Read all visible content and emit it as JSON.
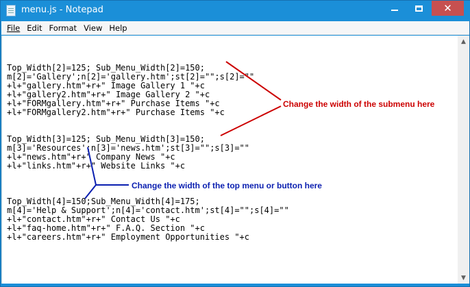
{
  "window": {
    "title": "menu.js - Notepad"
  },
  "titlebar": {
    "minimize_icon": "minimize-icon",
    "maximize_icon": "maximize-icon",
    "close_icon": "close-icon"
  },
  "menubar": {
    "items": [
      "File",
      "Edit",
      "Format",
      "View",
      "Help"
    ]
  },
  "editor": {
    "lines": [
      "",
      "Top_Width[2]=125; Sub_Menu_Width[2]=150;",
      "m[2]='Gallery';n[2]='gallery.htm';st[2]=\"\";s[2]=\"\"",
      "+l+\"gallery.htm\"+r+\" Image Gallery 1 \"+c",
      "+l+\"gallery2.htm\"+r+\" Image Gallery 2 \"+c",
      "+l+\"FORMgallery.htm\"+r+\" Purchase Items \"+c",
      "+l+\"FORMgallery2.htm\"+r+\" Purchase Items \"+c",
      "",
      "",
      "Top_Width[3]=125; Sub_Menu_Width[3]=150;",
      "m[3]='Resources';n[3]='news.htm';st[3]=\"\";s[3]=\"\"",
      "+l+\"news.htm\"+r+\" Company News \"+c",
      "+l+\"links.htm\"+r+\" Website Links \"+c",
      "",
      "",
      "",
      "Top_Width[4]=150;Sub_Menu_Width[4]=175;",
      "m[4]='Help & Support';n[4]='contact.htm';st[4]=\"\";s[4]=\"\"",
      "+l+\"contact.htm\"+r+\" Contact Us \"+c",
      "+l+\"faq-home.htm\"+r+\" F.A.Q. Section \"+c",
      "+l+\"careers.htm\"+r+\" Employment Opportunities \"+c"
    ]
  },
  "annotations": {
    "submenu_note": "Change the width of the submenu here",
    "topmenu_note": "Change the width of the top menu or button here",
    "submenu_color": "#cc0000",
    "topmenu_color": "#0a1fb0"
  },
  "colors": {
    "titlebar": "#1b8fd8",
    "close_button": "#c75050"
  }
}
